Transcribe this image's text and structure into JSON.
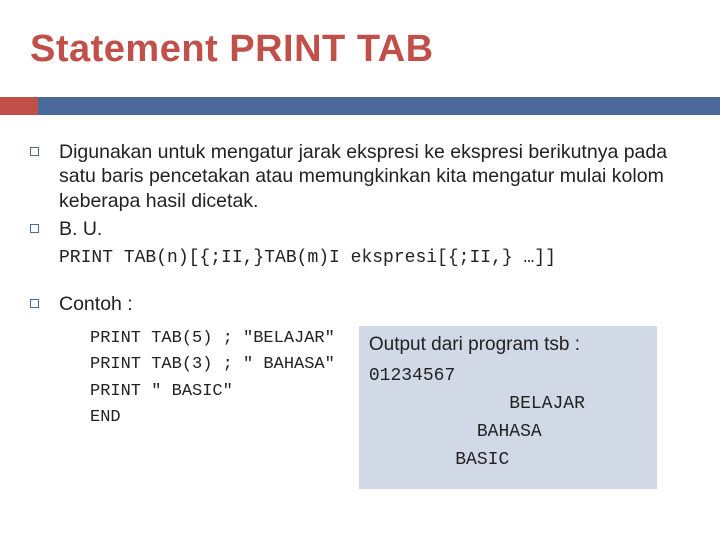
{
  "title": "Statement PRINT TAB",
  "bullets": {
    "item1": "Digunakan untuk mengatur jarak ekspresi ke ekspresi berikutnya pada satu baris pencetakan atau memungkinkan kita mengatur mulai kolom keberapa hasil dicetak.",
    "item2": " B. U."
  },
  "syntax": "PRINT TAB(n)[{;II,}TAB(m)I ekspresi[{;II,} …]]",
  "contoh_label": "Contoh :",
  "example_code": "PRINT TAB(5) ; \"BELAJAR\"\nPRINT TAB(3) ; \" BAHASA\"\nPRINT \" BASIC\"\nEND",
  "output": {
    "title": "Output dari program tsb :",
    "lines": "01234567\n             BELAJAR\n          BAHASA\n        BASIC"
  }
}
